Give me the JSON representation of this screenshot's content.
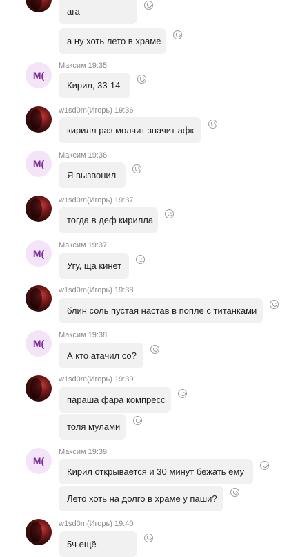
{
  "messages": [
    {
      "author": "",
      "time": "",
      "avatar": "photo",
      "lines": [
        "ага",
        "а ну хоть лето в храме"
      ]
    },
    {
      "author": "Максим",
      "time": "19:35",
      "avatar": "М(",
      "lines": [
        "Кирил, 33-14"
      ]
    },
    {
      "author": "w1sd0m(Игорь)",
      "time": "19:36",
      "avatar": "photo",
      "lines": [
        "кирилл раз молчит значит афк"
      ]
    },
    {
      "author": "Максим",
      "time": "19:36",
      "avatar": "М(",
      "lines": [
        "Я вызвонил"
      ]
    },
    {
      "author": "w1sd0m(Игорь)",
      "time": "19:37",
      "avatar": "photo",
      "lines": [
        "тогда в деф кирилла"
      ]
    },
    {
      "author": "Максим",
      "time": "19:37",
      "avatar": "М(",
      "lines": [
        "Угу, ща кинет"
      ]
    },
    {
      "author": "w1sd0m(Игорь)",
      "time": "19:38",
      "avatar": "photo",
      "lines": [
        "блин соль пустая настав в попле с титанками"
      ]
    },
    {
      "author": "Максим",
      "time": "19:38",
      "avatar": "М(",
      "lines": [
        "А кто атачил со?"
      ]
    },
    {
      "author": "w1sd0m(Игорь)",
      "time": "19:39",
      "avatar": "photo",
      "lines": [
        "параша фара компресс",
        "толя мулами"
      ]
    },
    {
      "author": "Максим",
      "time": "19:39",
      "avatar": "М(",
      "lines": [
        "Кирил открывается и 30 минут бежать ему",
        "Лето хоть на долго в храме у паши?"
      ]
    },
    {
      "author": "w1sd0m(Игорь)",
      "time": "19:40",
      "avatar": "photo",
      "lines": [
        "5ч ещё"
      ]
    }
  ],
  "icons": {
    "reaction": "smiley-icon",
    "avatar_photo": "user-photo-avatar"
  },
  "colors": {
    "bubble": "#f1f1f1",
    "avatar_initials_bg": "#f3e4f7",
    "avatar_initials_fg": "#7b2d98",
    "meta_text": "#8a8a8a"
  }
}
